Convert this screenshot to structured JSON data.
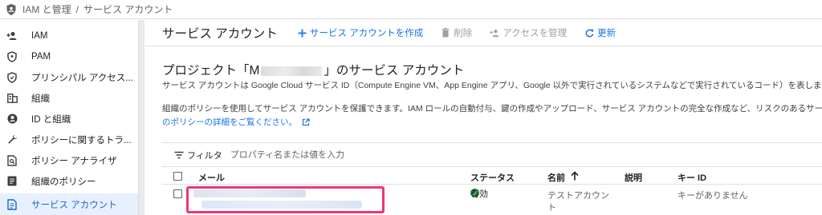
{
  "breadcrumb": {
    "root": "IAM と管理",
    "separator": "/",
    "current": "サービス アカウント"
  },
  "sidebar": {
    "items": [
      {
        "label": "IAM",
        "icon": "person-add-icon"
      },
      {
        "label": "PAM",
        "icon": "shield-icon"
      },
      {
        "label": "プリンシパル アクセス...",
        "icon": "principal-access-icon"
      },
      {
        "label": "組織",
        "icon": "organization-icon"
      },
      {
        "label": "ID と組織",
        "icon": "account-circle-icon"
      },
      {
        "label": "ポリシーに関するトラ...",
        "icon": "wrench-icon"
      },
      {
        "label": "ポリシー アナライザ",
        "icon": "policy-analyzer-icon"
      },
      {
        "label": "組織のポリシー",
        "icon": "document-icon"
      },
      {
        "label": "サービス アカウント",
        "icon": "service-account-icon",
        "active": true
      }
    ]
  },
  "header": {
    "title": "サービス アカウント",
    "create_label": "サービス アカウントを作成",
    "delete_label": "削除",
    "manage_access_label": "アクセスを管理",
    "refresh_label": "更新"
  },
  "main": {
    "title_prefix": "プロジェクト「M",
    "title_suffix": "」のサービス アカウント",
    "description": "サービス アカウントは Google Cloud サービス ID（Compute Engine VM、App Engine アプリ、Google 以外で実行されているシステムなどで実行されているコード）を表します。",
    "policy_text": "組織のポリシーを使用してサービス アカウントを保護できます。IAM ロールの自動付与、鍵の作成やアップロード、サービス アカウントの完全な作成など、リスクのあるサービ",
    "policy_link": "のポリシーの詳細をご覧ください。"
  },
  "filter": {
    "label": "フィルタ",
    "placeholder": "プロパティ名または値を入力"
  },
  "table": {
    "columns": {
      "email": "メール",
      "status": "ステータス",
      "name": "名前",
      "description": "説明",
      "key_id": "キー ID"
    },
    "rows": [
      {
        "status": "有効",
        "name_line1": "テストアカウン",
        "name_line2": "ト",
        "description": "",
        "key_id": "キーがありません"
      }
    ]
  },
  "colors": {
    "accent": "#1a73e8",
    "active_bg": "#e8f0fe",
    "highlight": "#f0357a",
    "status_ok": "#1e8e3e"
  }
}
